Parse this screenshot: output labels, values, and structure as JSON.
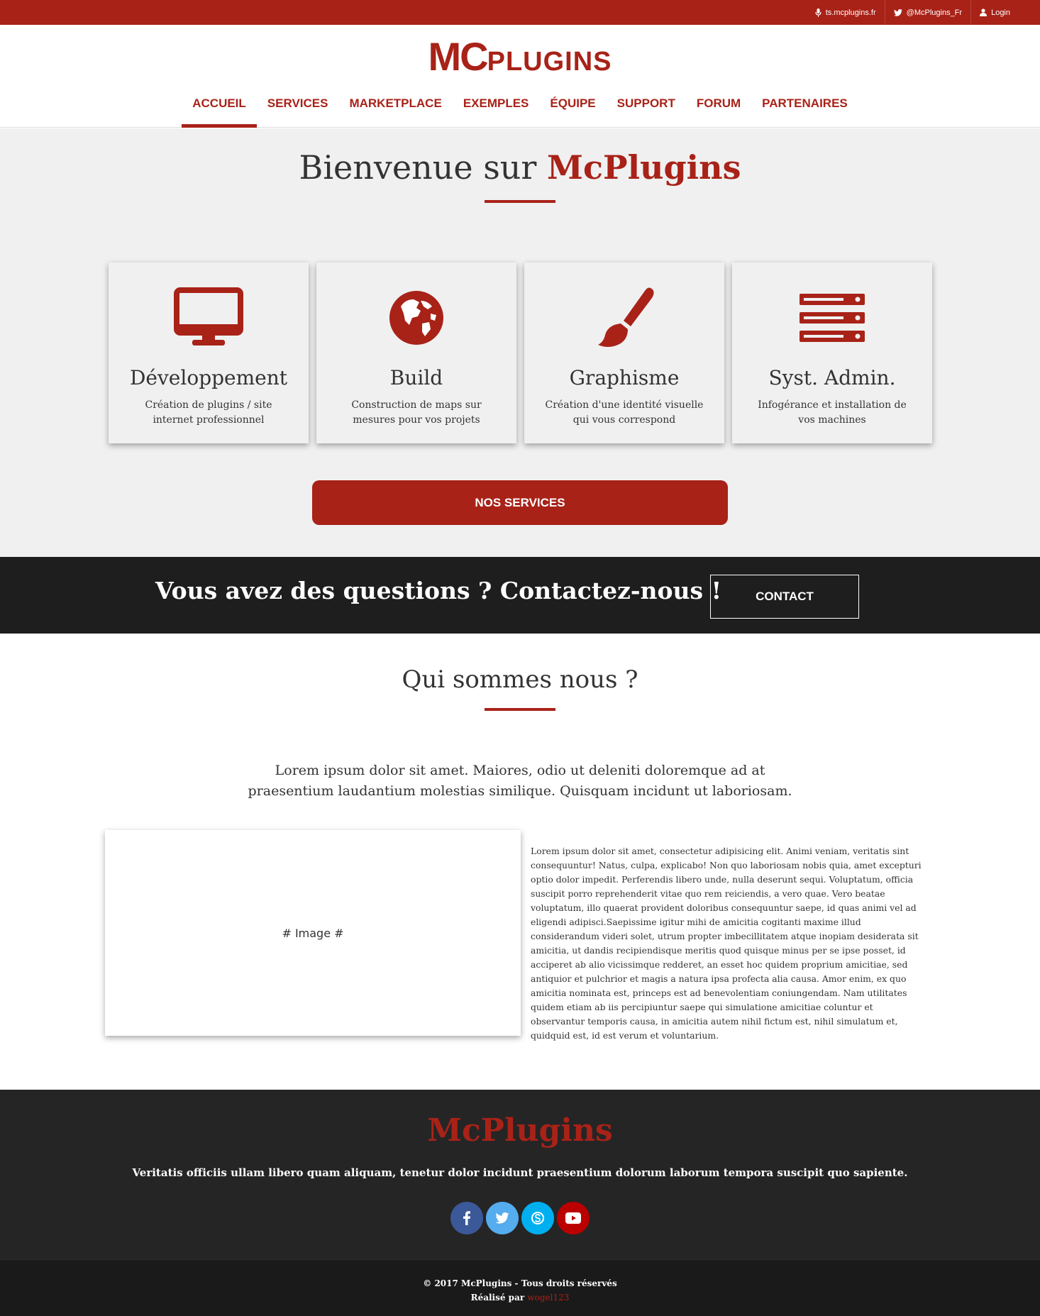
{
  "topbar": {
    "links": [
      {
        "label": "ts.mcplugins.fr",
        "icon": "microphone-icon"
      },
      {
        "label": "@McPlugins_Fr",
        "icon": "twitter-icon"
      },
      {
        "label": "Login",
        "icon": "user-icon"
      }
    ]
  },
  "header": {
    "logo_big": "MC",
    "logo_small": "PLUGINS",
    "nav": [
      "ACCUEIL",
      "SERVICES",
      "MARKETPLACE",
      "EXEMPLES",
      "ÉQUIPE",
      "SUPPORT",
      "FORUM",
      "PARTENAIRES"
    ],
    "active_nav": "ACCUEIL"
  },
  "welcome": {
    "title_prefix": "Bienvenue sur ",
    "title_brand": "McPlugins",
    "cards": [
      {
        "icon": "monitor-icon",
        "title": "Développement",
        "desc": "Création de plugins / site internet professionnel"
      },
      {
        "icon": "globe-icon",
        "title": "Build",
        "desc": "Construction de maps sur mesures pour vos projets"
      },
      {
        "icon": "paintbrush-icon",
        "title": "Graphisme",
        "desc": "Création d'une identité visuelle qui vous correspond"
      },
      {
        "icon": "server-icon",
        "title": "Syst. Admin.",
        "desc": "Infogérance et installation de vos machines"
      }
    ],
    "button_label": "NOS SERVICES"
  },
  "contact": {
    "text": "Vous avez des questions ? Contactez-nous !",
    "button_label": "CONTACT"
  },
  "about": {
    "title": "Qui sommes nous ?",
    "lead": "Lorem ipsum dolor sit amet. Maiores, odio ut deleniti doloremque ad at praesentium laudantium molestias similique. Quisquam incidunt ut laboriosam.",
    "image_placeholder": "# Image #",
    "body": "Lorem ipsum dolor sit amet, consectetur adipisicing elit. Animi veniam, veritatis sint consequuntur! Natus, culpa, explicabo! Non quo laboriosam nobis quia, amet excepturi optio dolor impedit. Perferendis libero unde, nulla deserunt sequi. Voluptatum, officia suscipit porro reprehenderit vitae quo rem reiciendis, a vero quae. Vero beatae voluptatum, illo quaerat provident doloribus consequuntur saepe, id quas animi vel ad eligendi adipisci.Saepissime igitur mihi de amicitia cogitanti maxime illud considerandum videri solet, utrum propter imbecillitatem atque inopiam desiderata sit amicitia, ut dandis recipiendisque meritis quod quisque minus per se ipse posset, id acciperet ab alio vicissimque redderet, an esset hoc quidem proprium amicitiae, sed antiquior et pulchrior et magis a natura ipsa profecta alia causa. Amor enim, ex quo amicitia nominata est, princeps est ad benevolentiam coniungendam. Nam utilitates quidem etiam ab iis percipiuntur saepe qui simulatione amicitiae coluntur et observantur temporis causa, in amicitia autem nihil fictum est, nihil simulatum et, quidquid est, id est verum et voluntarium."
  },
  "footer": {
    "logo": "McPlugins",
    "tagline": "Veritatis officiis ullam libero quam aliquam, tenetur dolor incidunt praesentium dolorum laborum tempora suscipit quo sapiente.",
    "socials": [
      {
        "icon": "facebook-icon",
        "color": "#3b5998"
      },
      {
        "icon": "twitter-icon",
        "color": "#55acee"
      },
      {
        "icon": "skype-icon",
        "color": "#00aff0"
      },
      {
        "icon": "youtube-icon",
        "color": "#bb0000"
      }
    ],
    "copyright": "© 2017 McPlugins - Tous droits réservés",
    "made_by_prefix": "Réalisé par ",
    "made_by_author": "wogel123"
  },
  "colors": {
    "accent": "#a82218",
    "dark_band": "#1e1e1e",
    "footer": "#252525",
    "light_bg": "#f0f0f0"
  }
}
